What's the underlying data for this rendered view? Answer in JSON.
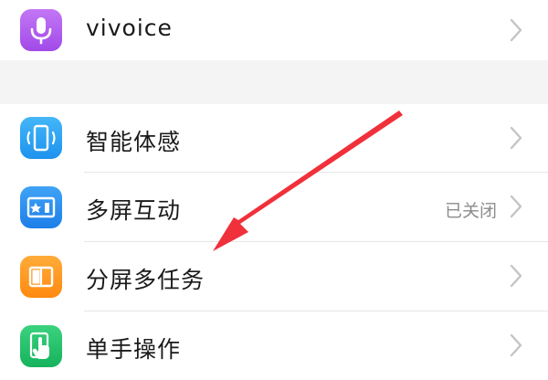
{
  "settings": {
    "items": [
      {
        "label": "vivoice",
        "icon": "microphone-icon",
        "color": "#b45cf0"
      },
      {
        "label": "智能体感",
        "icon": "motion-sense-icon",
        "color": "#2fa6f5"
      },
      {
        "label": "多屏互动",
        "icon": "multi-screen-icon",
        "color": "#2f8ff0",
        "status": "已关闭"
      },
      {
        "label": "分屏多任务",
        "icon": "split-screen-icon",
        "color": "#ff9a1f"
      },
      {
        "label": "单手操作",
        "icon": "one-hand-icon",
        "color": "#25c26b"
      }
    ]
  },
  "annotation": {
    "arrow_color": "#f0303a"
  }
}
